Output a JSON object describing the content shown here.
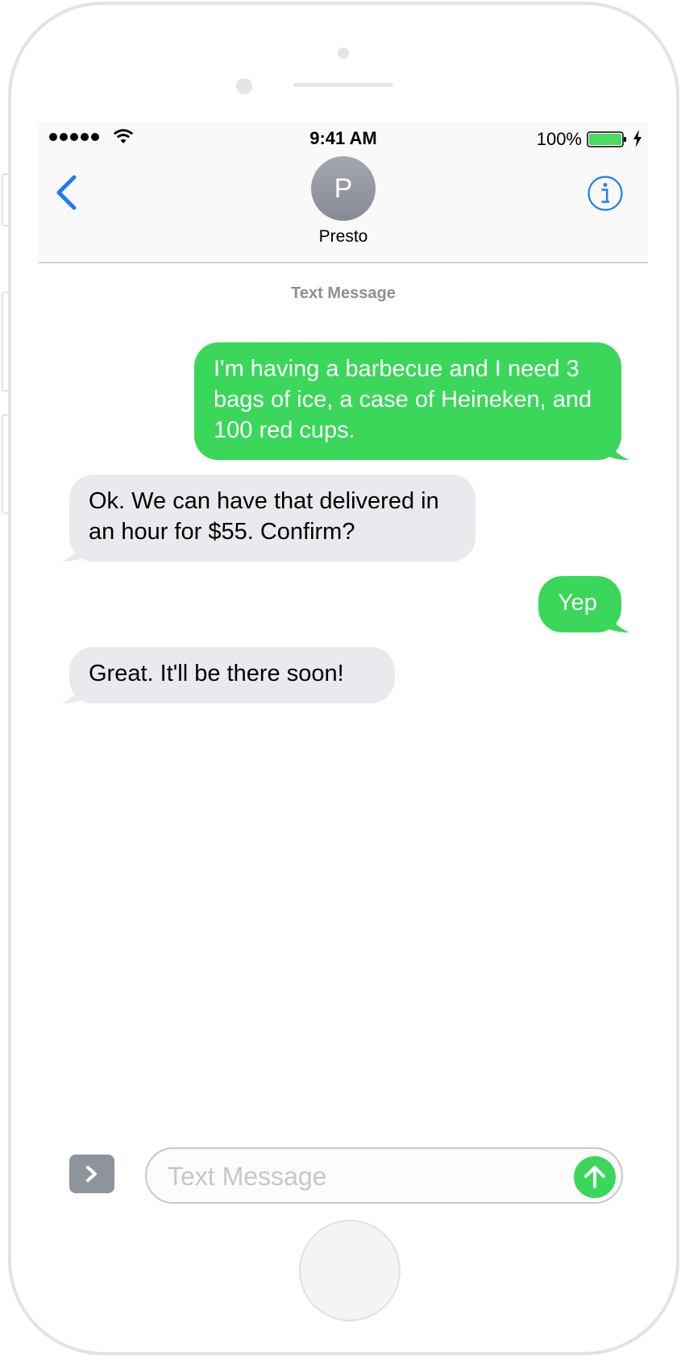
{
  "status_bar": {
    "time": "9:41 AM",
    "battery": "100%"
  },
  "header": {
    "avatar_initial": "P",
    "contact_name": "Presto"
  },
  "thread": {
    "label": "Text Message",
    "messages": [
      {
        "direction": "sent",
        "text": "I'm having a barbecue and I need 3 bags of ice, a case of Heineken, and 100 red cups."
      },
      {
        "direction": "received",
        "text": "Ok. We can have that delivered in an hour for $55. Confirm?"
      },
      {
        "direction": "sent",
        "text": "Yep"
      },
      {
        "direction": "received",
        "text": "Great. It'll be there soon!"
      }
    ]
  },
  "composer": {
    "placeholder": "Text Message",
    "value": ""
  },
  "icons": {
    "back": "chevron-left-icon",
    "info": "info-icon",
    "wifi": "wifi-icon",
    "battery": "battery-icon",
    "charging": "bolt-icon",
    "apps": "chevron-right-icon",
    "send": "arrow-up-icon"
  },
  "colors": {
    "sent_bubble": "#3ad75a",
    "received_bubble": "#e9e9ee",
    "accent": "#1e7cf2",
    "battery": "#4cd964"
  }
}
